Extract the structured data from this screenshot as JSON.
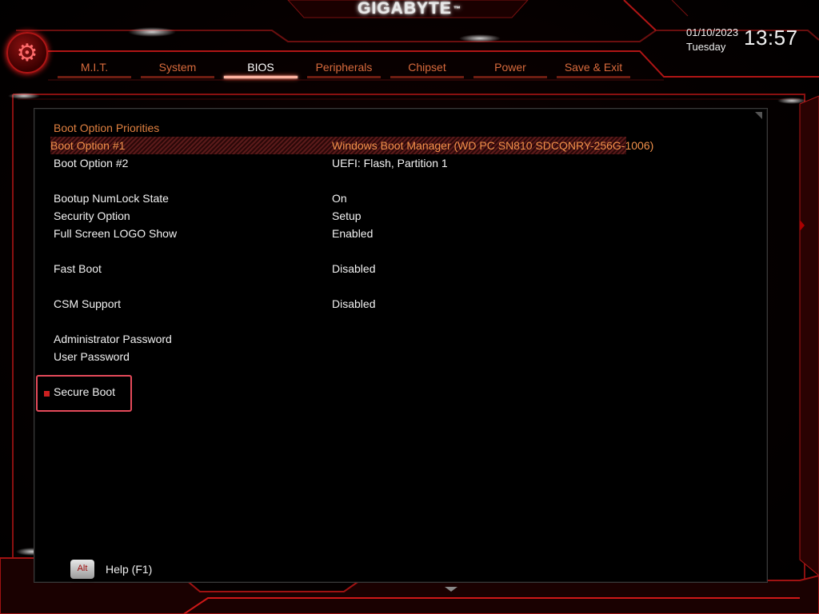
{
  "brand": {
    "name": "GIGABYTE",
    "tm": "™"
  },
  "clock": {
    "date": "01/10/2023",
    "day": "Tuesday",
    "time": "13:57"
  },
  "tabs": [
    {
      "label": "M.I.T."
    },
    {
      "label": "System"
    },
    {
      "label": "BIOS",
      "active": true
    },
    {
      "label": "Peripherals"
    },
    {
      "label": "Chipset"
    },
    {
      "label": "Power"
    },
    {
      "label": "Save & Exit"
    }
  ],
  "settings": {
    "header": "Boot Option Priorities",
    "boot1": {
      "label": "Boot Option #1",
      "value": "Windows Boot Manager (WD PC SN810 SDCQNRY-256G-1006)"
    },
    "boot2": {
      "label": "Boot Option #2",
      "value": "UEFI: Flash, Partition 1"
    },
    "numlock": {
      "label": "Bootup NumLock State",
      "value": "On"
    },
    "security": {
      "label": "Security Option",
      "value": "Setup"
    },
    "logo": {
      "label": "Full Screen LOGO Show",
      "value": "Enabled"
    },
    "fastboot": {
      "label": "Fast Boot",
      "value": "Disabled"
    },
    "csm": {
      "label": "CSM Support",
      "value": "Disabled"
    },
    "admin_pw": {
      "label": "Administrator Password"
    },
    "user_pw": {
      "label": "User Password"
    },
    "secure_boot": {
      "label": "Secure Boot"
    }
  },
  "help": {
    "key": "Alt",
    "label": "Help (F1)"
  },
  "icons": {
    "settings": "gear-icon",
    "scroll": "triangle-icon"
  },
  "colors": {
    "accent": "#d86a3c",
    "frame": "#b01515",
    "highlight_box": "#e54a5a"
  }
}
